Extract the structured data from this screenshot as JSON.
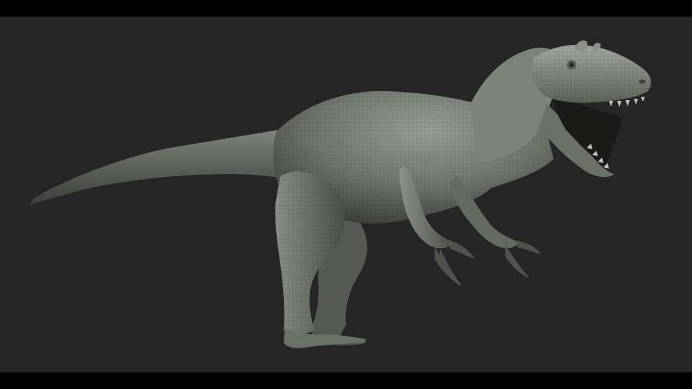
{
  "scene": {
    "subject": "dinosaur-sculpt",
    "colors": {
      "letterbox": "#000000",
      "background": "#262626",
      "skin_light": "#8f968c",
      "skin_mid": "#6d7469",
      "skin_dark": "#3e433c",
      "mouth": "#1a1b19",
      "teeth": "#c9c3b6"
    }
  }
}
